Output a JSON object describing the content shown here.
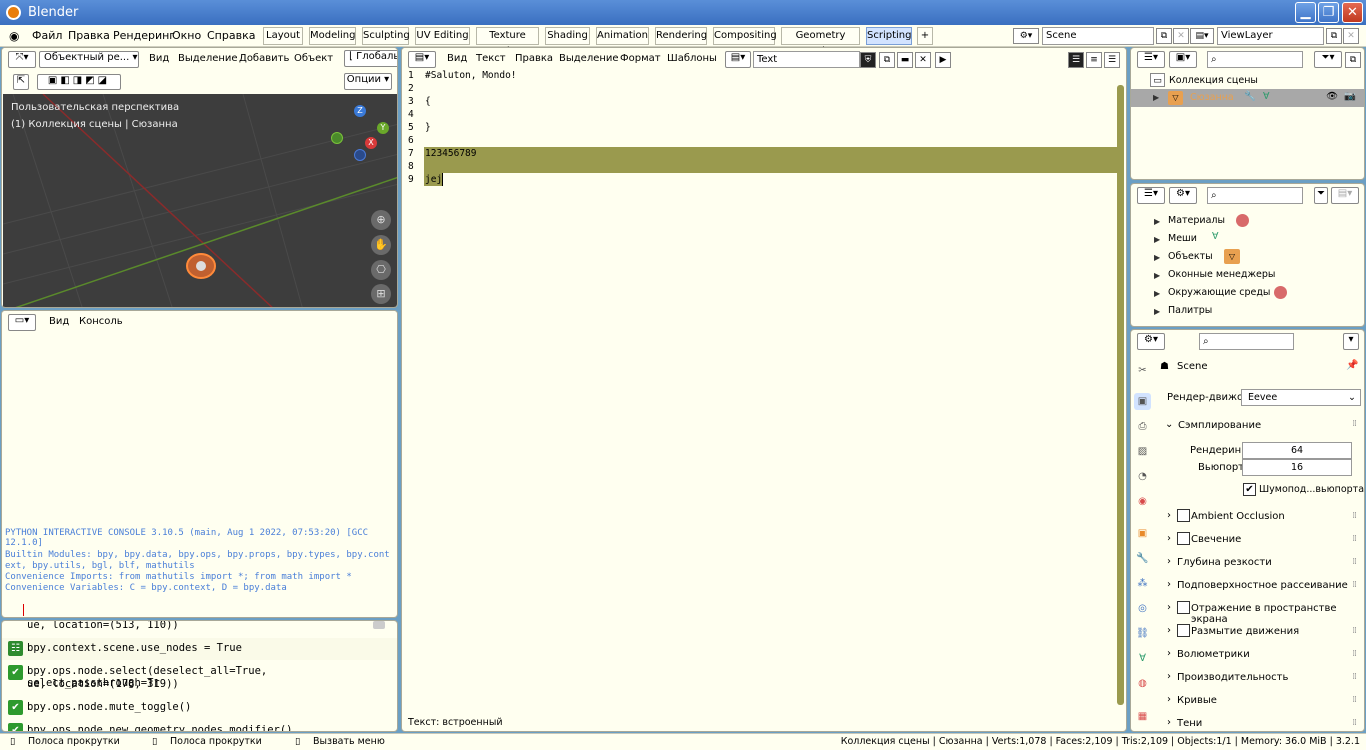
{
  "window": {
    "title": "Blender"
  },
  "menu": [
    "Файл",
    "Правка",
    "Рендеринг",
    "Окно",
    "Справка"
  ],
  "workspaces": [
    "Layout",
    "Modeling",
    "Sculpting",
    "UV Editing",
    "Texture Paint",
    "Shading",
    "Animation",
    "Rendering",
    "Compositing",
    "Geometry Nodes",
    "Scripting"
  ],
  "active_workspace": "Scripting",
  "scene_name": "Scene",
  "view_layer": "ViewLayer",
  "viewport": {
    "mode": "Объектный ре...",
    "menus": [
      "Вид",
      "Выделение",
      "Добавить",
      "Объект"
    ],
    "orientation": "Глобаль",
    "options": "Опции",
    "perspective": "Пользовательская перспектива",
    "collection_info": "(1) Коллекция сцены | Сюзанна",
    "gizmo": {
      "z": "Z",
      "y": "Y",
      "x": "X"
    }
  },
  "console": {
    "menus": [
      "Вид",
      "Консоль"
    ],
    "lines": [
      "PYTHON INTERACTIVE CONSOLE 3.10.5 (main, Aug  1 2022, 07:53:20) [GCC 12.1.0]",
      "",
      "Builtin Modules:       bpy, bpy.data, bpy.ops, bpy.props, bpy.types, bpy.cont",
      "ext, bpy.utils, bgl, blf, mathutils",
      "Convenience Imports:   from mathutils import *; from math import *",
      "Convenience Variables: C = bpy.context, D = bpy.data"
    ]
  },
  "info_log": [
    "ue, location=(513, 110))",
    "bpy.context.scene.use_nodes = True",
    "bpy.ops.node.select(deselect_all=True, select_passthrough=Tr",
    "ue, location=(178, 319))",
    "bpy.ops.node.mute_toggle()",
    "bpy.ops.node.new_geometry_nodes_modifier()"
  ],
  "text_editor": {
    "menus": [
      "Вид",
      "Текст",
      "Правка",
      "Выделение",
      "Формат",
      "Шаблоны"
    ],
    "text_name": "Text",
    "lines": [
      {
        "n": "1",
        "t": "#Saluton, Mondo!"
      },
      {
        "n": "2",
        "t": ""
      },
      {
        "n": "3",
        "t": "{"
      },
      {
        "n": "4",
        "t": ""
      },
      {
        "n": "5",
        "t": "}"
      },
      {
        "n": "6",
        "t": ""
      },
      {
        "n": "7",
        "t": "123456789"
      },
      {
        "n": "8",
        "t": ""
      },
      {
        "n": "9",
        "t": "jej"
      }
    ],
    "footer": "Текст: встроенный"
  },
  "outliner": {
    "scene_collection": "Коллекция сцены",
    "object": "Сюзанна"
  },
  "data_browser": {
    "items": [
      "Материалы",
      "Меши",
      "Объекты",
      "Оконные менеджеры",
      "Окружающие среды",
      "Палитры"
    ]
  },
  "properties": {
    "scene": "Scene",
    "render_engine_label": "Рендер-движок",
    "render_engine": "Eevee",
    "sampling": "Сэмплирование",
    "render_label": "Рендеринг",
    "render_samples": "64",
    "viewport_label": "Вьюпорт",
    "viewport_samples": "16",
    "denoise": "Шумопод...вьюпорта",
    "sections": [
      "Ambient Occlusion",
      "Свечение",
      "Глубина резкости",
      "Подповерхностное рассеивание",
      "Отражение в пространстве экрана",
      "Размытие движения",
      "Волюметрики",
      "Производительность",
      "Кривые",
      "Тени"
    ]
  },
  "status": {
    "left": [
      "Полоса прокрутки",
      "Полоса прокрутки",
      "Вызвать меню"
    ],
    "right": "Коллекция сцены | Сюзанна | Verts:1,078 | Faces:2,109 | Tris:2,109 | Objects:1/1 | Memory: 36.0 MiB | 3.2.1"
  },
  "colors": {
    "highlight": "#9a9a4e",
    "accent": "#d2e3ff",
    "console_text": "#4a7fd8"
  }
}
